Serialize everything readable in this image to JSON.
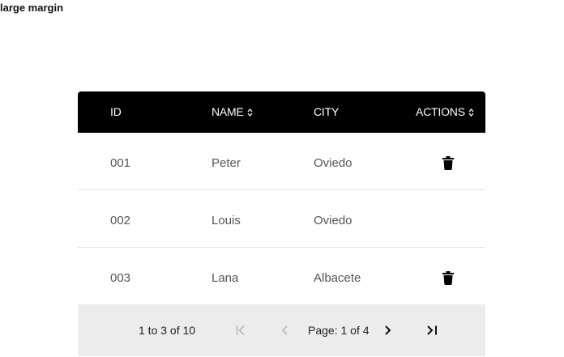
{
  "page": {
    "label": "large margin"
  },
  "table": {
    "columns": [
      {
        "key": "id",
        "label": "ID",
        "sortable": false
      },
      {
        "key": "name",
        "label": "NAME",
        "sortable": true
      },
      {
        "key": "city",
        "label": "CITY",
        "sortable": false
      },
      {
        "key": "actions",
        "label": "ACTIONS",
        "sortable": true
      }
    ],
    "rows": [
      {
        "id": "001",
        "name": "Peter",
        "city": "Oviedo",
        "deletable": true
      },
      {
        "id": "002",
        "name": "Louis",
        "city": "Oviedo",
        "deletable": false
      },
      {
        "id": "003",
        "name": "Lana",
        "city": "Albacete",
        "deletable": true
      }
    ]
  },
  "pagination": {
    "summary": "1 to 3 of 10",
    "page_info": "Page: 1 of 4",
    "icons": {
      "first": "first-page-icon",
      "prev": "prev-page-icon",
      "next": "next-page-icon",
      "last": "last-page-icon"
    }
  },
  "colors": {
    "header_bg": "#000000",
    "header_text": "#ffffff",
    "footer_bg": "#ececec",
    "disabled_icon": "#b5b5b5",
    "row_border": "#e3e3e3"
  }
}
